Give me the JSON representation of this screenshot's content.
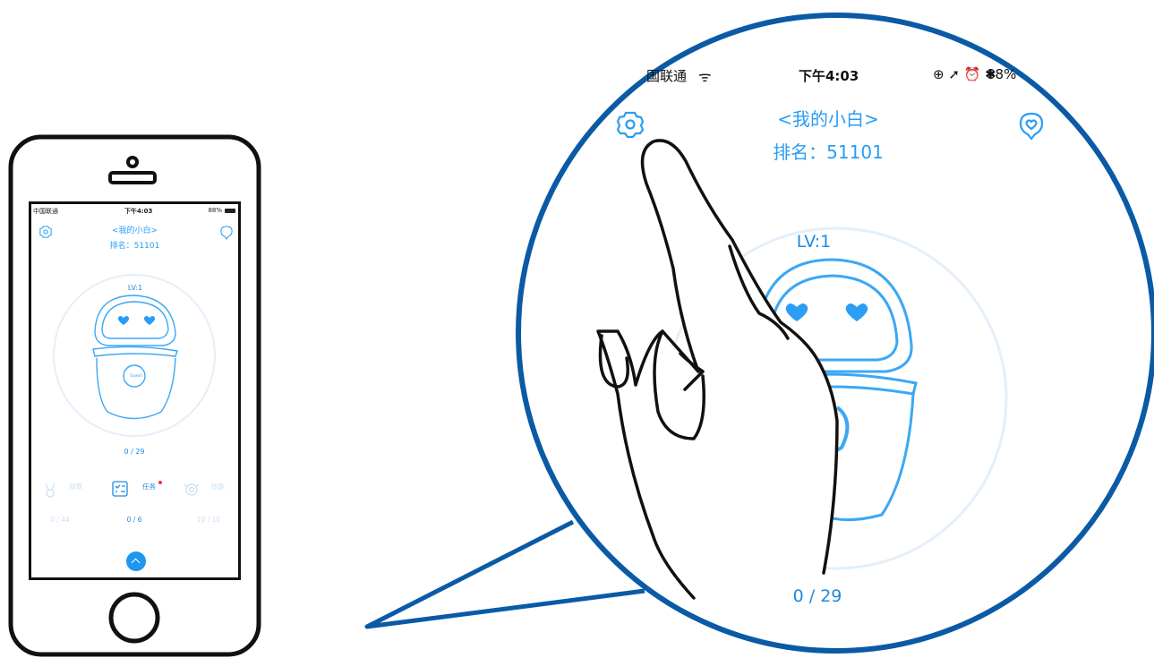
{
  "status_bar": {
    "carrier": "中国联通",
    "carrier_magnified": "国联通",
    "time": "下午4:03",
    "battery": "88%",
    "battery_magnified": "88%"
  },
  "pet": {
    "name": "<我的小白>",
    "rank": "排名：51101",
    "level": "LV:1",
    "progress": "0 / 29",
    "progress_magnified": "0 / 29",
    "badge_text": "Gowild"
  },
  "stats": [
    {
      "label": "勋章",
      "count": "0 / 44",
      "active": false
    },
    {
      "label": "任务",
      "count": "0 / 6",
      "active": true
    },
    {
      "label": "技能",
      "count": "10 / 10",
      "active": false
    }
  ],
  "icons": {
    "settings": "gear-icon",
    "message": "heart-message-icon",
    "expand": "chevron-up-icon",
    "hand": "pointing-hand-icon"
  },
  "colors": {
    "accent": "#2a9df4",
    "robot_line": "#3aa8f5",
    "callout_border": "#0a5aa6",
    "notification_dot": "#e8334a"
  }
}
